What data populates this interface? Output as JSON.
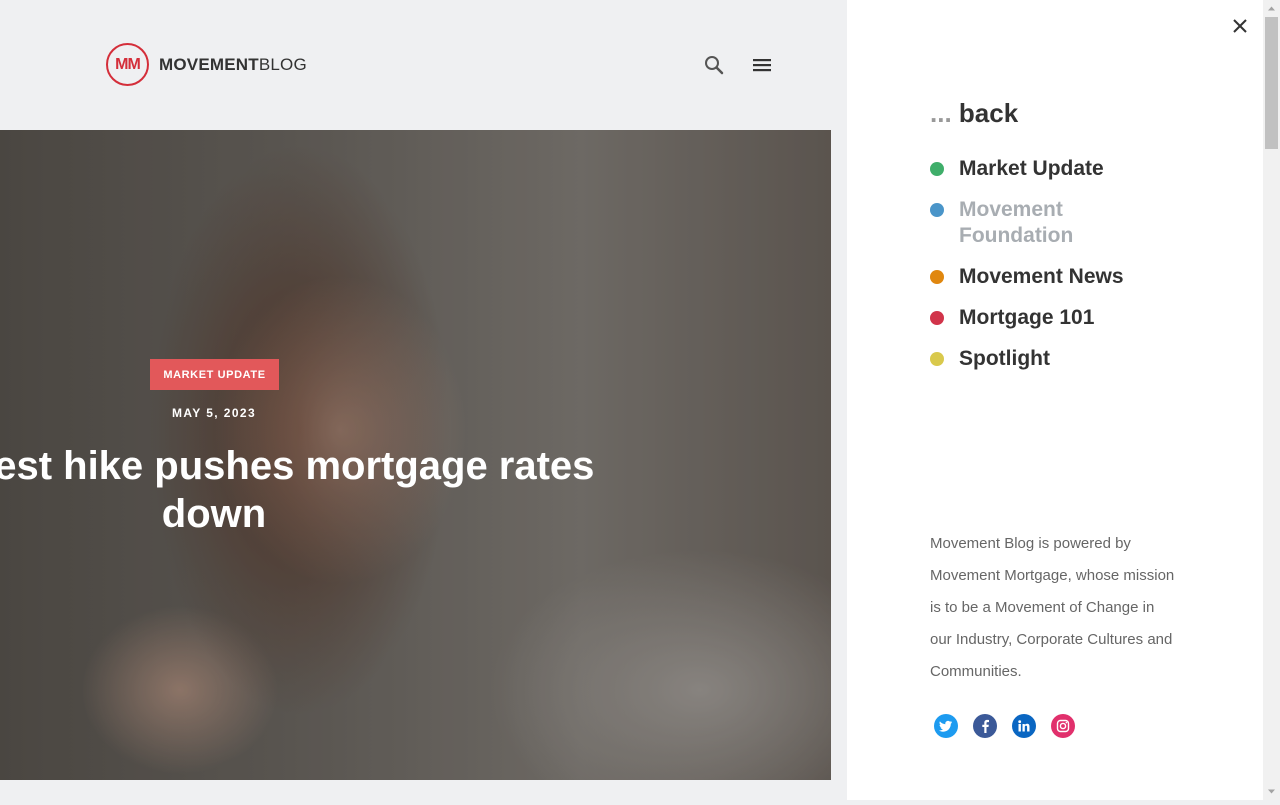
{
  "header": {
    "logo_mark": "MM",
    "logo_bold": "MOVEMENT",
    "logo_thin": "BLOG"
  },
  "hero": {
    "category_tag": "MARKET UPDATE",
    "date": "MAY 5, 2023",
    "headline": "Fed's latest hike pushes mortgage rates down"
  },
  "panel": {
    "back_dots": "...",
    "back_label": "back",
    "categories": [
      {
        "label": "Market Update",
        "color": "#3fae6a"
      },
      {
        "label": "Movement Foundation",
        "color": "#4a95c9"
      },
      {
        "label": "Movement News",
        "color": "#e0870f"
      },
      {
        "label": "Mortgage 101",
        "color": "#d1344a"
      },
      {
        "label": "Spotlight",
        "color": "#d9c94c"
      }
    ],
    "about_text": "Movement Blog is powered by Movement Mortgage, whose mission is to be a Movement of Change in our Industry, Corporate Cultures and Communities.",
    "social": [
      "twitter-icon",
      "facebook-icon",
      "linkedin-icon",
      "instagram-icon"
    ]
  },
  "colors": {
    "brand_red": "#d42e3a",
    "tag_bg": "#e2585a",
    "header_bg": "#eff0f2"
  }
}
